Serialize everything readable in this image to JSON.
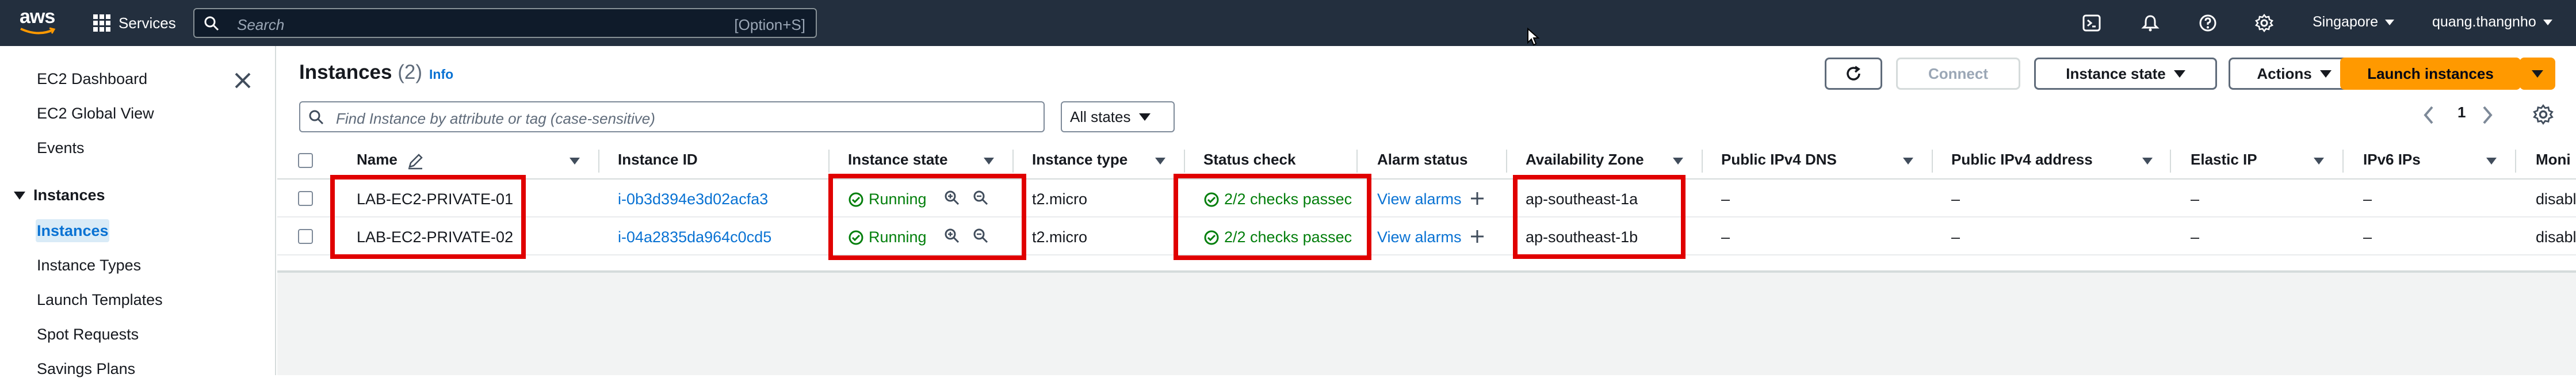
{
  "topnav": {
    "logo_text": "aws",
    "services_label": "Services",
    "search_placeholder": "Search",
    "search_shortcut": "[Option+S]",
    "region": "Singapore",
    "account": "quang.thangnho",
    "icons": [
      "cloudshell-icon",
      "bell-icon",
      "help-icon",
      "settings-icon"
    ]
  },
  "sidebar": {
    "items_top": [
      "EC2 Dashboard",
      "EC2 Global View",
      "Events"
    ],
    "section": "Instances",
    "section_items": [
      "Instances",
      "Instance Types",
      "Launch Templates",
      "Spot Requests",
      "Savings Plans"
    ],
    "active": "Instances"
  },
  "main": {
    "title": "Instances",
    "count": "(2)",
    "info": "Info",
    "buttons": {
      "connect": "Connect",
      "instance_state": "Instance state",
      "actions": "Actions",
      "launch": "Launch instances"
    },
    "filter_placeholder": "Find Instance by attribute or tag (case-sensitive)",
    "states_select": "All states",
    "page": "1",
    "columns": [
      "Name",
      "Instance ID",
      "Instance state",
      "Instance type",
      "Status check",
      "Alarm status",
      "Availability Zone",
      "Public IPv4 DNS",
      "Public IPv4 address",
      "Elastic IP",
      "IPv6 IPs",
      "Moni"
    ],
    "rows": [
      {
        "name": "LAB-EC2-PRIVATE-01",
        "id": "i-0b3d394e3d02acfa3",
        "state": "Running",
        "type": "t2.micro",
        "status": "2/2 checks passec",
        "alarm": "View alarms",
        "az": "ap-southeast-1a",
        "dns": "–",
        "ipv4": "–",
        "eip": "–",
        "ipv6": "–",
        "moni": "disabl"
      },
      {
        "name": "LAB-EC2-PRIVATE-02",
        "id": "i-04a2835da964c0cd5",
        "state": "Running",
        "type": "t2.micro",
        "status": "2/2 checks passec",
        "alarm": "View alarms",
        "az": "ap-southeast-1b",
        "dns": "–",
        "ipv4": "–",
        "eip": "–",
        "ipv6": "–",
        "moni": "disabl"
      }
    ]
  },
  "colors": {
    "nav_bg": "#232f3e",
    "accent": "#ff9900",
    "link": "#0972d3",
    "success": "#037f0c",
    "highlight": "#e00000"
  }
}
